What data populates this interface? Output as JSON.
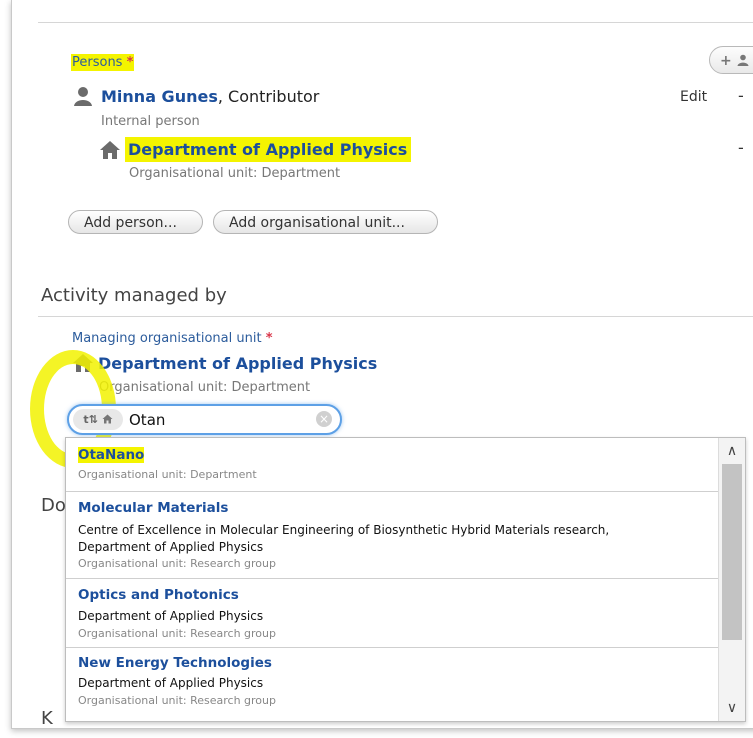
{
  "persons": {
    "label": "Persons",
    "required_mark": "*",
    "add_icon_text": "+",
    "person": {
      "name": "Minna Gunes",
      "role": ", Contributor",
      "type": "Internal person",
      "edit_label": "Edit",
      "remove_label": "-"
    },
    "department": {
      "name": "Department of Applied Physics",
      "type": "Organisational unit: Department",
      "remove_label": "-"
    },
    "add_person_button": "Add person...",
    "add_org_button": "Add organisational unit..."
  },
  "managed_by": {
    "title": "Activity managed by",
    "field_label": "Managing organisational unit",
    "required_mark": "*",
    "department": {
      "name": "Department of Applied Physics",
      "type": "Organisational unit: Department"
    },
    "search": {
      "prefix_label": "t⇅",
      "value": "Otan",
      "clear_icon": "×"
    }
  },
  "background_partial": {
    "doc_text": "Do",
    "k_text": "K"
  },
  "dropdown": {
    "results": [
      {
        "title": "OtaNano",
        "lines": [],
        "subtitle": "Organisational unit: Department"
      },
      {
        "title": "Molecular Materials",
        "lines": [
          "Centre of Excellence in Molecular Engineering of Biosynthetic Hybrid Materials research,",
          "Department of Applied Physics"
        ],
        "subtitle": "Organisational unit: Research group"
      },
      {
        "title": "Optics and Photonics",
        "lines": [
          "Department of Applied Physics"
        ],
        "subtitle": "Organisational unit: Research group"
      },
      {
        "title": "New Energy Technologies",
        "lines": [
          "Department of Applied Physics"
        ],
        "subtitle": "Organisational unit: Research group"
      }
    ],
    "scroll_up_icon": "∧",
    "scroll_down_icon": "∨"
  },
  "colors": {
    "highlight": "#f4f400",
    "link_blue": "#1c4f9c",
    "required_red": "#d9364a",
    "focus_blue": "#5da0e6"
  }
}
